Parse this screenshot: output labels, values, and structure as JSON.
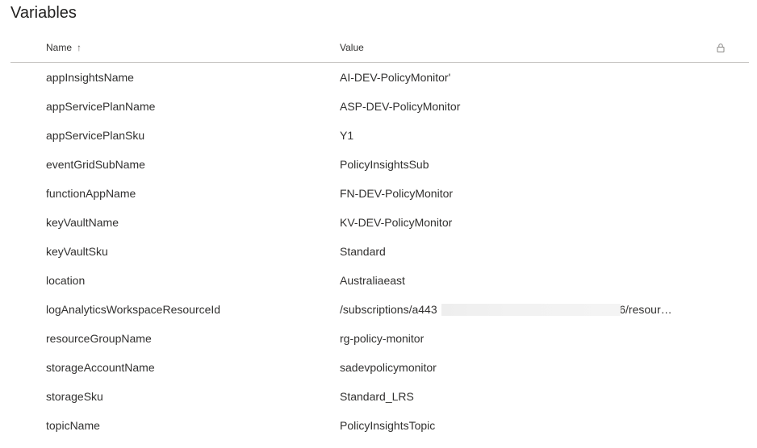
{
  "page": {
    "title": "Variables"
  },
  "table": {
    "columns": {
      "name": "Name",
      "value": "Value",
      "sort_indicator": "↑"
    },
    "rows": [
      {
        "name": "appInsightsName",
        "value": "AI-DEV-PolicyMonitor'"
      },
      {
        "name": "appServicePlanName",
        "value": "ASP-DEV-PolicyMonitor"
      },
      {
        "name": "appServicePlanSku",
        "value": "Y1"
      },
      {
        "name": "eventGridSubName",
        "value": "PolicyInsightsSub"
      },
      {
        "name": "functionAppName",
        "value": "FN-DEV-PolicyMonitor"
      },
      {
        "name": "keyVaultName",
        "value": "KV-DEV-PolicyMonitor"
      },
      {
        "name": "keyVaultSku",
        "value": "Standard"
      },
      {
        "name": "location",
        "value": "Australiaeast"
      },
      {
        "name": "logAnalyticsWorkspaceResourceId",
        "value": "/subscriptions/a443                                                  698a6/resour…"
      },
      {
        "name": "resourceGroupName",
        "value": "rg-policy-monitor"
      },
      {
        "name": "storageAccountName",
        "value": "sadevpolicymonitor"
      },
      {
        "name": "storageSku",
        "value": "Standard_LRS"
      },
      {
        "name": "topicName",
        "value": "PolicyInsightsTopic"
      }
    ]
  },
  "icons": {
    "lock": "lock-icon",
    "sort": "arrow-up-icon"
  }
}
